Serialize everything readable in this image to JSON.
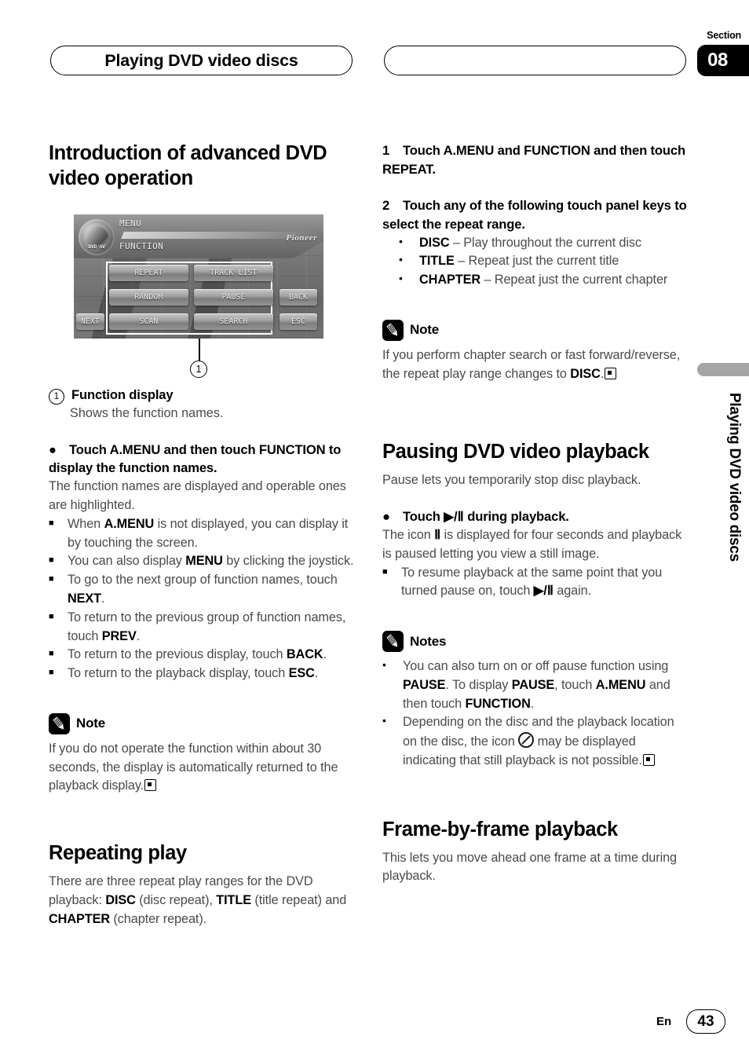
{
  "header": {
    "chapter_title": "Playing DVD video discs",
    "section_label": "Section",
    "section_number": "08"
  },
  "side_tab": {
    "vertical_text": "Playing DVD video discs"
  },
  "footer": {
    "language": "En",
    "page_number": "43"
  },
  "device_screenshot": {
    "logo_text": "DVD/AV",
    "menu_label": "MENU",
    "function_label": "FUNCTION",
    "brand": "Pioneer",
    "buttons": {
      "repeat": "REPEAT",
      "track_list": "TRACK LIST",
      "random": "RANDOM",
      "pause": "PAUSE",
      "scan": "SCAN",
      "search": "SEARCH",
      "back": "BACK",
      "esc": "ESC",
      "next": "NEXT"
    },
    "callout_number": "1"
  },
  "left_column": {
    "heading_intro": "Introduction of advanced DVD video operation",
    "callout": {
      "number": "1",
      "label": "Function display",
      "description": "Shows the function names."
    },
    "bullet_instruction": {
      "marker": "●",
      "text": "Touch A.MENU and then touch FUNCTION to display the function names."
    },
    "paragraph_1": "The function names are displayed and operable ones are highlighted.",
    "square_bullets": [
      {
        "pre": "When ",
        "b1": "A.MENU",
        "post": " is not displayed, you can display it by touching the screen."
      },
      {
        "pre": "You can also display ",
        "b1": "MENU",
        "post": " by clicking the joystick."
      },
      {
        "pre": "To go to the next group of function names, touch ",
        "b1": "NEXT",
        "post": "."
      },
      {
        "pre": "To return to the previous group of function names, touch ",
        "b1": "PREV",
        "post": "."
      },
      {
        "pre": "To return to the previous display, touch ",
        "b1": "BACK",
        "post": "."
      },
      {
        "pre": "To return to the playback display, touch ",
        "b1": "ESC",
        "post": "."
      }
    ],
    "note": {
      "title": "Note",
      "text": "If you do not operate the function within about 30 seconds, the display is automatically returned to the playback display."
    },
    "heading_repeating": "Repeating play",
    "repeating_paragraph": {
      "p1": "There are three repeat play ranges for the DVD playback: ",
      "b1": "DISC",
      "p2": " (disc repeat), ",
      "b2": "TITLE",
      "p3": " (title repeat) and ",
      "b3": "CHAPTER",
      "p4": " (chapter repeat)."
    }
  },
  "right_column": {
    "step_1": {
      "number": "1",
      "text": "Touch A.MENU and FUNCTION and then touch REPEAT."
    },
    "step_2": {
      "number": "2",
      "text": "Touch any of the following touch panel keys to select the repeat range."
    },
    "repeat_options": [
      {
        "key": "DISC",
        "desc": " – Play throughout the current disc"
      },
      {
        "key": "TITLE",
        "desc": " – Repeat just the current title"
      },
      {
        "key": "CHAPTER",
        "desc": " – Repeat just the current chapter"
      }
    ],
    "note_repeat": {
      "title": "Note",
      "pre": "If you perform chapter search or fast forward/reverse, the repeat play range changes to ",
      "bold": "DISC",
      "post": "."
    },
    "heading_pausing": "Pausing DVD video playback",
    "pausing_intro": "Pause lets you temporarily stop disc playback.",
    "pause_instruction": {
      "marker": "●",
      "pre": "Touch ",
      "glyph": "▶/Ⅱ",
      "post": " during playback."
    },
    "pause_paragraph": {
      "pre": "The icon ",
      "glyph": "Ⅱ",
      "post": " is displayed for four seconds and playback is paused letting you view a still image."
    },
    "pause_square_bullet": {
      "pre": "To resume playback at the same point that you turned pause on, touch ",
      "glyph": "▶/Ⅱ",
      "post": " again."
    },
    "notes": {
      "title": "Notes",
      "items": [
        {
          "parts": [
            "You can also turn on or off pause function using ",
            "PAUSE",
            ". To display ",
            "PAUSE",
            ", touch ",
            "A.MENU",
            " and then touch ",
            "FUNCTION",
            "."
          ]
        },
        {
          "pre": "Depending on the disc and the playback location on the disc, the icon ",
          "icon": "prohibited-icon",
          "post": " may be displayed indicating that still playback is not possible."
        }
      ]
    },
    "heading_frame": "Frame-by-frame playback",
    "frame_paragraph": "This lets you move ahead one frame at a time during playback."
  }
}
